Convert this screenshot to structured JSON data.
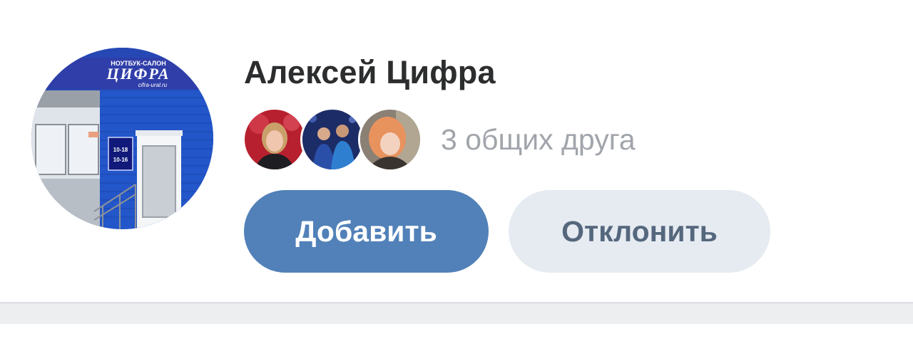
{
  "request": {
    "name": "Алексей Цифра",
    "avatar": {
      "sign_main": "ЦИФРА",
      "sign_top": "НОУТБУК-САЛОН",
      "sign_url": "cifra-ural.ru",
      "hours": [
        "10-18",
        "10-16"
      ]
    },
    "mutual_friends": {
      "text": "3 общих друга",
      "avatars": [
        {
          "icon": "friend-avatar-woman-red-background"
        },
        {
          "icon": "friend-avatar-two-men"
        },
        {
          "icon": "friend-avatar-redhead-woman"
        }
      ]
    },
    "actions": {
      "add_label": "Добавить",
      "decline_label": "Отклонить"
    }
  },
  "colors": {
    "primary_button": "#5181b8",
    "secondary_button": "#e5ebf1",
    "secondary_text": "#55677d",
    "muted_text": "#a1a5ab",
    "name_text": "#2c2d2e"
  }
}
